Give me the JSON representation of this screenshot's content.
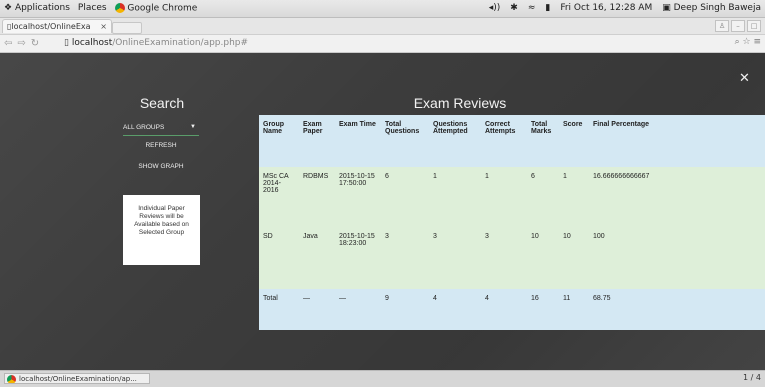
{
  "system_bar": {
    "applications": "Applications",
    "places": "Places",
    "app_name": "Google Chrome",
    "datetime": "Fri Oct 16, 12:28 AM",
    "user": "Deep Singh Baweja"
  },
  "browser": {
    "tab_title": "localhost/OnlineExa",
    "url_host": "localhost",
    "url_path": "/OnlineExamination/app.php#"
  },
  "search_panel": {
    "title": "Search",
    "group_select_value": "ALL GROUPS",
    "refresh_label": "REFRESH",
    "show_graph_label": "SHOW GRAPH",
    "info_text": "Individual Paper Reviews will be Available based on Selected Group"
  },
  "reviews": {
    "title": "Exam Reviews",
    "columns": [
      "Group Name",
      "Exam Paper",
      "Exam Time",
      "Total Questions",
      "Questions Attempted",
      "Correct Attempts",
      "Total Marks",
      "Score",
      "Final Percentage"
    ],
    "rows": [
      [
        "MSc CA 2014-2016",
        "RDBMS",
        "2015-10-15 17:50:00",
        "6",
        "1",
        "1",
        "6",
        "1",
        "16.666666666667"
      ],
      [
        "SD",
        "Java",
        "2015-10-15 18:23:00",
        "3",
        "3",
        "3",
        "10",
        "10",
        "100"
      ]
    ],
    "total": [
      "Total",
      "—",
      "—",
      "9",
      "4",
      "4",
      "16",
      "11",
      "68.75"
    ]
  },
  "taskbar": {
    "item_label": "localhost/OnlineExamination/ap...",
    "pager": "1 / 4"
  },
  "colors": {
    "header_bg": "#d4e8f3",
    "row_bg": "#deefd9",
    "page_bg": "#3c3c3c"
  }
}
